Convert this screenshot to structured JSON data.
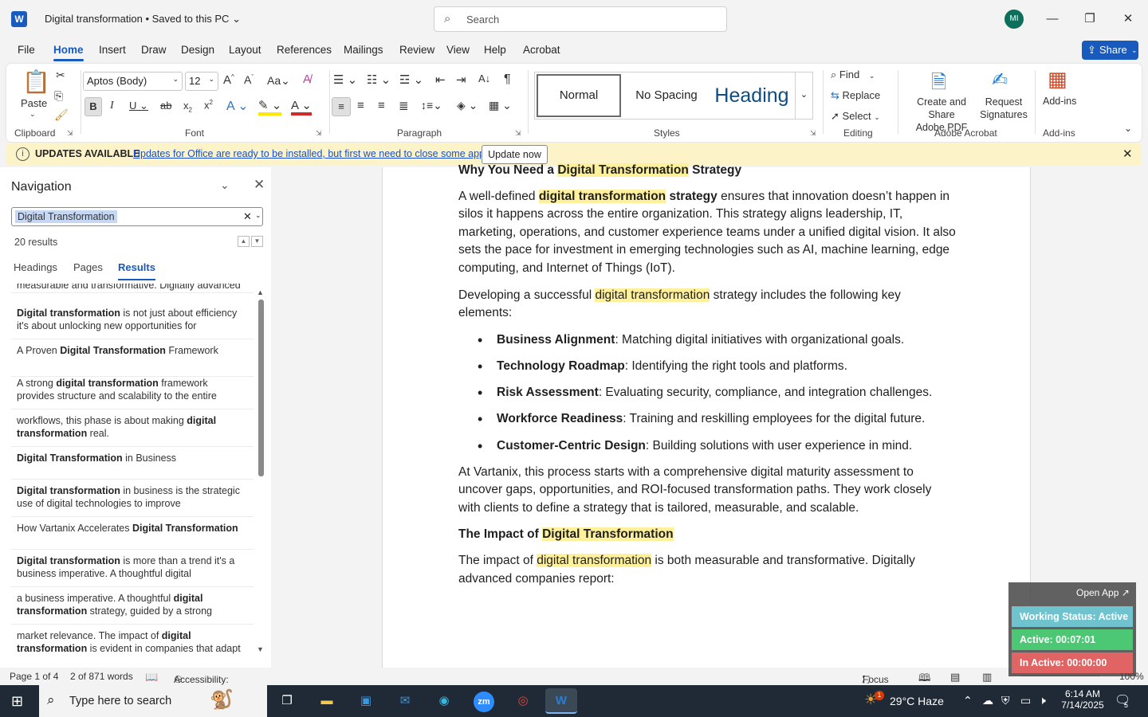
{
  "app": {
    "doc_title": "Digital transformation • Saved to this PC",
    "search_placeholder": "Search",
    "user_initials": "MI",
    "logo_letter": "W"
  },
  "menu": {
    "tabs": [
      "File",
      "Home",
      "Insert",
      "Draw",
      "Design",
      "Layout",
      "References",
      "Mailings",
      "Review",
      "View",
      "Help",
      "Acrobat"
    ],
    "active": "Home",
    "share_label": "Share"
  },
  "ribbon": {
    "clipboard": {
      "paste": "Paste",
      "label": "Clipboard"
    },
    "font": {
      "name": "Aptos (Body)",
      "size": "12",
      "label": "Font"
    },
    "paragraph": {
      "label": "Paragraph"
    },
    "styles": {
      "items": [
        "Normal",
        "No Spacing",
        "Heading"
      ],
      "label": "Styles"
    },
    "editing": {
      "find": "Find",
      "replace": "Replace",
      "select": "Select",
      "label": "Editing"
    },
    "acrobat": {
      "create": "Create and Share",
      "create2": "Adobe PDF",
      "request": "Request",
      "request2": "Signatures",
      "label": "Adobe Acrobat"
    },
    "addins": {
      "button": "Add-ins",
      "label": "Add-ins"
    }
  },
  "notice": {
    "title": "UPDATES AVAILABLE",
    "message": "Updates for Office are ready to be installed, but first we need to close some apps.",
    "button": "Update now",
    "color": "#fcf4c8"
  },
  "navigation": {
    "title": "Navigation",
    "search_value": "Digital Transformation",
    "results_count": "20 results",
    "tabs": [
      "Headings",
      "Pages",
      "Results"
    ],
    "active_tab": "Results",
    "results": [
      {
        "pre": "measurable and transformative. Digitally advanced",
        "bold": "",
        "post": ""
      },
      {
        "pre": "",
        "bold": "Digital transformation",
        "post": " is not just about efficiency it's about unlocking new opportunities for"
      },
      {
        "pre": "A Proven ",
        "bold": "Digital Transformation",
        "post": " Framework"
      },
      {
        "pre": "A strong ",
        "bold": "digital transformation",
        "post": " framework provides structure and scalability to the entire"
      },
      {
        "pre": "workflows, this phase is about making ",
        "bold": "digital transformation",
        "post": " real."
      },
      {
        "pre": "",
        "bold": "Digital Transformation",
        "post": " in Business"
      },
      {
        "pre": "",
        "bold": "Digital transformation",
        "post": " in business is the strategic use of digital technologies to improve"
      },
      {
        "pre": "How Vartanix Accelerates ",
        "bold": "Digital Transformation",
        "post": ""
      },
      {
        "pre": "",
        "bold": "Digital transformation",
        "post": " is more than a trend it's a business imperative. A thoughtful digital"
      },
      {
        "pre": "a business imperative. A thoughtful ",
        "bold": "digital transformation",
        "post": " strategy, guided by a strong"
      },
      {
        "pre": "market relevance. The impact of ",
        "bold": "digital transformation",
        "post": " is evident in companies that adapt"
      }
    ]
  },
  "document": {
    "h1_pre": "Why You Need a ",
    "h1_hl": "Digital Transformation",
    "h1_post": " Strategy",
    "p1_pre": "A well-defined ",
    "p1_hl": "digital transformation",
    "p1_bold": " strategy",
    "p1_post": " ensures that innovation doesn’t happen in silos it happens across the entire organization. This strategy aligns leadership, IT, marketing, operations, and customer experience teams under a unified digital vision. It also sets the pace for investment in emerging technologies such as AI, machine learning, edge computing, and Internet of Things (IoT).",
    "p2_pre": "Developing a successful ",
    "p2_hl": "digital transformation",
    "p2_post": " strategy includes the following key elements:",
    "bullets": [
      {
        "term": "Business Alignment",
        "desc": ": Matching digital initiatives with organizational goals."
      },
      {
        "term": "Technology Roadmap",
        "desc": ": Identifying the right tools and platforms."
      },
      {
        "term": "Risk Assessment",
        "desc": ": Evaluating security, compliance, and integration challenges."
      },
      {
        "term": "Workforce Readiness",
        "desc": ": Training and reskilling employees for the digital future."
      },
      {
        "term": "Customer-Centric Design",
        "desc": ": Building solutions with user experience in mind."
      }
    ],
    "p3": "At Vartanix, this process starts with a comprehensive digital maturity assessment to uncover gaps, opportunities, and ROI-focused transformation paths. They work closely with clients to define a strategy that is tailored, measurable, and scalable.",
    "h2_pre": "The Impact of ",
    "h2_hl": "Digital Transformation",
    "p4_pre": "The impact of ",
    "p4_hl": "digital transformation",
    "p4_post": " is both measurable and transformative. Digitally advanced companies report:"
  },
  "widget": {
    "open_label": "Open App ↗",
    "working": "Working Status: Active",
    "active": "Active: 00:07:01",
    "inactive": "In Active: 00:00:00",
    "colors": {
      "working": "#6fc3cf",
      "active": "#4cc774",
      "inactive": "#e06464"
    }
  },
  "statusbar": {
    "page": "Page 1 of 4",
    "words": "2 of 871 words",
    "accessibility": "Accessibility: Good to go",
    "focus": "Focus",
    "zoom": "100%"
  },
  "taskbar": {
    "search_placeholder": "Type here to search",
    "weather": "29°C  Haze",
    "weather_badge": "1",
    "time": "6:14 AM",
    "date": "7/14/2025",
    "notif_count": "5"
  }
}
